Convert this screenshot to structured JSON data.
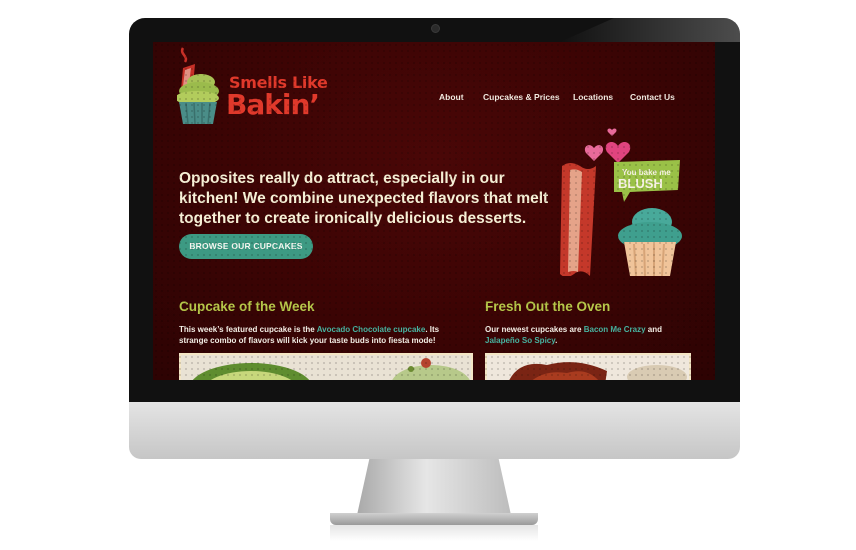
{
  "site": {
    "logo": {
      "line1": "Smells Like",
      "line2": "Bakin’"
    },
    "nav": [
      {
        "label": "About"
      },
      {
        "label": "Cupcakes & Prices"
      },
      {
        "label": "Locations"
      },
      {
        "label": "Contact Us"
      }
    ],
    "hero": {
      "text": "Opposites really do attract, especially in our kitchen! We combine unexpected flavors that melt together to create ironically delicious desserts.",
      "cta_label": "BROWSE OUR CUPCAKES"
    },
    "illustration": {
      "sign_line1": "You bake me",
      "sign_line2": "BLUSH"
    },
    "cupcake_of_week": {
      "title": "Cupcake of the Week",
      "text_before": "This week’s featured cupcake is the ",
      "link": "Avocado Chocolate cupcake",
      "text_after": ". Its strange combo of flavors will kick your taste buds into fiesta mode!"
    },
    "fresh_out": {
      "title": "Fresh Out the Oven",
      "text_before": "Our newest cupcakes are ",
      "link1": "Bacon Me Crazy",
      "text_mid": " and",
      "link2": "Jalapeño So Spicy",
      "text_after": "."
    }
  },
  "colors": {
    "background": "#3b0404",
    "accent_red": "#e0392b",
    "accent_green": "#b6c84a",
    "accent_teal": "#3d9a83",
    "text_cream": "#f6f0d6"
  }
}
